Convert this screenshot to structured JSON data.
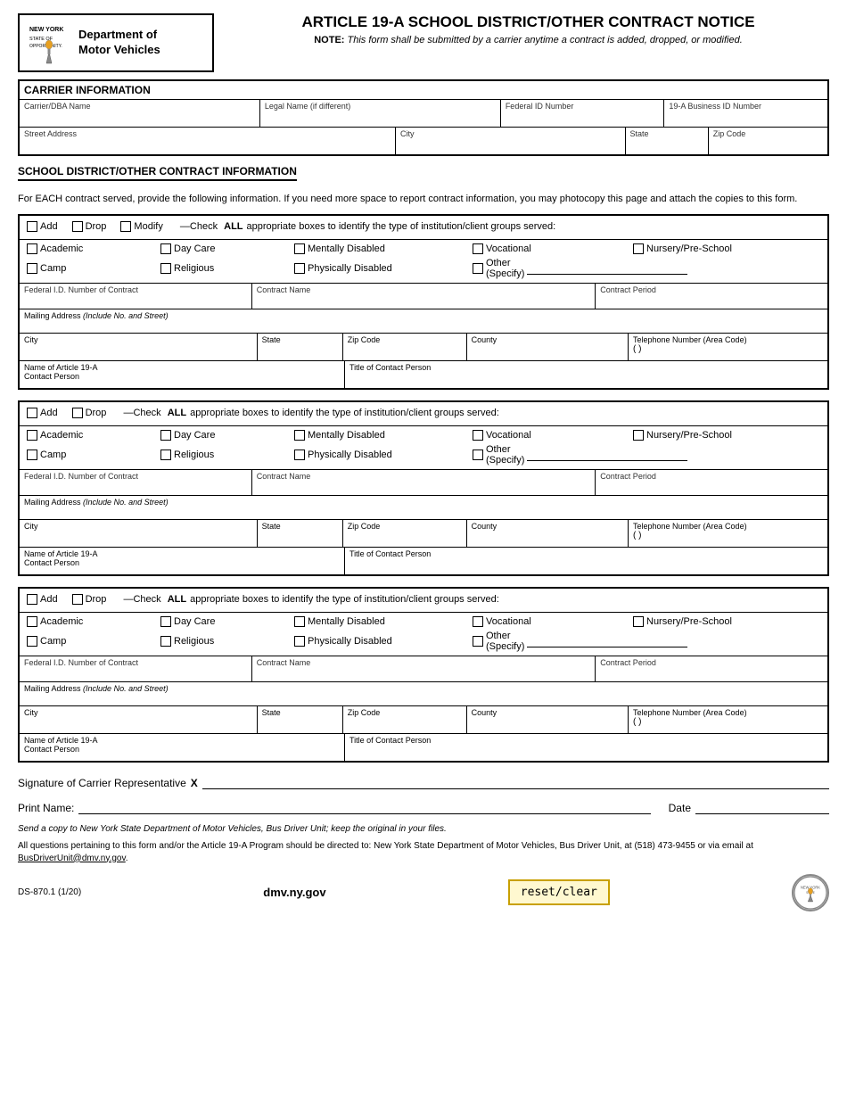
{
  "header": {
    "logo_top": "NEW YORK",
    "logo_sub": "STATE OF OPPORTUNITY.",
    "dept_line1": "Department of",
    "dept_line2": "Motor Vehicles",
    "title": "ARTICLE 19-A SCHOOL DISTRICT/OTHER CONTRACT NOTICE",
    "note_label": "NOTE:",
    "note_text": "This form shall be submitted by a carrier anytime a contract is added, dropped, or modified."
  },
  "carrier_section": {
    "title": "CARRIER INFORMATION",
    "field1_label": "Carrier/DBA Name",
    "field2_label": "Legal Name (if different)",
    "field3_label": "Federal ID Number",
    "field4_label": "19-A Business ID Number",
    "field5_label": "Street Address",
    "field6_label": "City",
    "field7_label": "State",
    "field8_label": "Zip Code"
  },
  "school_section": {
    "title": "SCHOOL DISTRICT/OTHER CONTRACT INFORMATION",
    "description": "For EACH contract served, provide the following information. If you need more space to report contract information, you may photocopy this page and attach the copies to this form.",
    "add_label": "Add",
    "drop_label": "Drop",
    "modify_label": "Modify",
    "check_text": "—Check",
    "all_label": "ALL",
    "after_all": " appropriate boxes to identify the type of institution/client groups served:",
    "checkboxes_row1": [
      "Academic",
      "Day Care",
      "Mentally Disabled",
      "Vocational",
      "Nursery/Pre-School"
    ],
    "checkboxes_row2": [
      "Camp",
      "Religious",
      "Physically Disabled",
      "Other (Specify)"
    ],
    "fed_id_label": "Federal I.D. Number of Contract",
    "contract_name_label": "Contract Name",
    "contract_period_label": "Contract Period",
    "mailing_label": "Mailing Address (Include No. and Street)",
    "city_label": "City",
    "state_label": "State",
    "zip_label": "Zip Code",
    "county_label": "County",
    "tel_label": "Telephone Number (Area Code)",
    "name_19a_label": "Name of Article 19-A",
    "contact_person_label": "Contact Person",
    "title_contact_label": "Title of Contact Person"
  },
  "contract_blocks": [
    {
      "id": 1
    },
    {
      "id": 2
    },
    {
      "id": 3
    }
  ],
  "signature": {
    "sig_label": "Signature of Carrier Representative",
    "x_mark": "X",
    "print_label": "Print Name:",
    "date_label": "Date"
  },
  "footer": {
    "send_copy_text": "Send a copy to New York State Department of Motor Vehicles, Bus Driver Unit; keep the original in your files.",
    "questions_text": "All questions pertaining to this form and/or the Article 19-A Program should be directed to: New York State Department of Motor Vehicles, Bus Driver Unit, at (518) 473-9455 or via email at",
    "email": "BusDriverUnit@dmv.ny.gov",
    "email_suffix": ".",
    "ds_number": "DS-870.1 (1/20)",
    "url": "dmv.ny.gov",
    "reset_label": "reset/clear"
  }
}
